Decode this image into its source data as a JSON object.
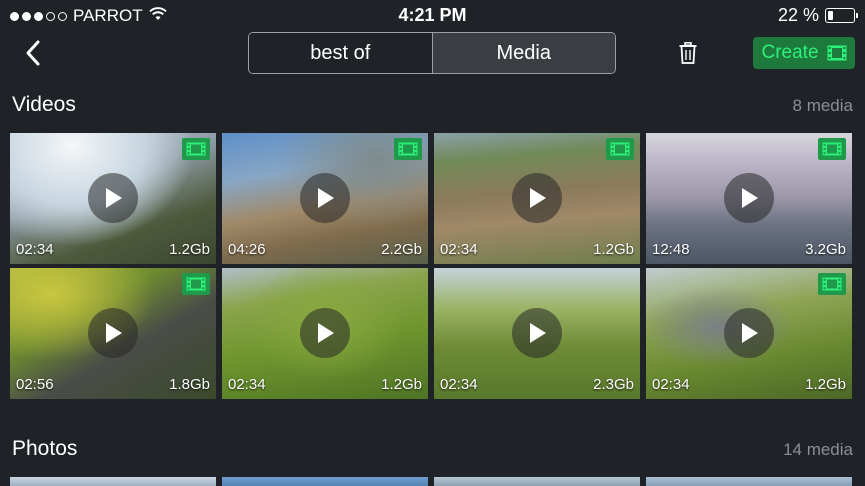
{
  "status": {
    "carrier": "PARROT",
    "time": "4:21 PM",
    "battery_text": "22 %",
    "battery_level": 0.22
  },
  "nav": {
    "segments": [
      {
        "label": "best of",
        "active": true
      },
      {
        "label": "Media",
        "active": false
      }
    ],
    "create_label": "Create",
    "icons": {
      "back": "chevron-left-icon",
      "trash": "trash-icon",
      "film": "film-icon"
    }
  },
  "videos": {
    "title": "Videos",
    "count": "8 media",
    "items": [
      {
        "duration": "02:34",
        "size": "1.2Gb",
        "in_film": true
      },
      {
        "duration": "04:26",
        "size": "2.2Gb",
        "in_film": true
      },
      {
        "duration": "02:34",
        "size": "1.2Gb",
        "in_film": true
      },
      {
        "duration": "12:48",
        "size": "3.2Gb",
        "in_film": true
      },
      {
        "duration": "02:56",
        "size": "1.8Gb",
        "in_film": true
      },
      {
        "duration": "02:34",
        "size": "1.2Gb",
        "in_film": false
      },
      {
        "duration": "02:34",
        "size": "2.3Gb",
        "in_film": false
      },
      {
        "duration": "02:34",
        "size": "1.2Gb",
        "in_film": true
      }
    ]
  },
  "photos": {
    "title": "Photos",
    "count": "14 media"
  },
  "colors": {
    "background": "#1f2226",
    "accent_green": "#2cf07a",
    "badge_green": "#1e9a4a",
    "muted_text": "#8a8f95"
  }
}
